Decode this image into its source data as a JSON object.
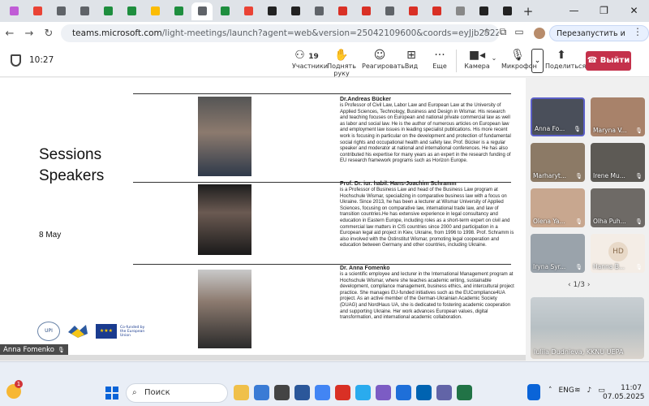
{
  "browser": {
    "tabs": [
      {
        "color": "#c05cd6"
      },
      {
        "color": "#ea4335"
      },
      {
        "color": "#5f6368"
      },
      {
        "color": "#5f6368"
      },
      {
        "color": "#1e8e3e"
      },
      {
        "color": "#1e8e3e"
      },
      {
        "color": "#fbbc04"
      },
      {
        "color": "#1e8e3e"
      },
      {
        "color": "#5f6368",
        "active": true
      },
      {
        "color": "#1e8e3e"
      },
      {
        "color": "#ea4335"
      },
      {
        "color": "#222222"
      },
      {
        "color": "#222222"
      },
      {
        "color": "#5f6368"
      },
      {
        "color": "#d93025"
      },
      {
        "color": "#d93025"
      },
      {
        "color": "#5f6368"
      },
      {
        "color": "#d93025"
      },
      {
        "color": "#d93025"
      },
      {
        "color": "#888888"
      },
      {
        "color": "#222222"
      },
      {
        "color": "#222222"
      }
    ],
    "new_tab": "+",
    "url_main": "teams.microsoft.com",
    "url_rest": "/light-meetings/launch?agent=web&version=25042109600&coords=eyJjb252ZXJzYXRpb25JZCI6Ij...",
    "relaunch_label": "Перезапустить и обновить"
  },
  "meeting": {
    "time": "10:27",
    "participants_count": "19",
    "participants_label": "Участники",
    "raise_hand_label": "Поднять руку",
    "react_label": "Реагировать",
    "view_label": "Вид",
    "more_label": "Еще",
    "camera_label": "Камера",
    "mic_label": "Микрофон",
    "share_label": "Поделиться",
    "leave_label": "Выйти"
  },
  "slide": {
    "title_line1": "Sessions",
    "title_line2": "Speakers",
    "date": "8 May",
    "speakers": [
      {
        "name": "Dr.Andreas Bücker",
        "bio": "is Professor of Civil Law, Labor Law and European Law at the University of Applied Sciences, Technology, Business and Design in Wismar. His research and teaching focuses on European and national private commercial law as well as labor and social law. He is the author of numerous articles on European law and employment law issues in leading specialist publications. His more recent work is focusing in particular on the development and protection of fundamental social rights and occupational health and safety law. Prof. Bücker is a regular speaker and moderator at national and international conferences. He has also contributed his expertise for many years as an expert in the research funding of EU research framework programs such as Horizon Europe."
      },
      {
        "name": "Prof. Dr. iur. habil. Hans-Joachim Schramm",
        "bio": "is a Professor of Business Law and head of the Business Law program at Hochschule Wismar, specializing in comparative business law with a focus on Ukraine. Since 2013, he has been a lecturer at Wismar University of Applied Sciences, focusing on comparative law, international trade law, and law of transition countries.He has extensive experience in legal consultancy and education in Eastern Europe, including roles as a short-term expert on civil and commercial law matters in CIS countries since 2000 and participation in a European legal aid project in Kiev, Ukraine, from 1996 to 1998. Prof. Schramm is also involved with the Ostinstitut Wismar, promoting legal cooperation and education between Germany and other countries, including Ukraine."
      },
      {
        "name": "Dr. Anna Fomenko",
        "bio": "is a scientific employee and lecturer in the International Management program at Hochschule Wismar, where she teaches academic writing, sustainable development, compliance management, business ethics, and intercultural project practice. She manages EU-funded initiatives such as the EUCompliance4UA project. As an active member of the German-Ukrainian Academic Society (DUAG) and NordHaus UA, she is dedicated to fostering academic cooperation and supporting Ukraine. Her work advances European values, digital transformation, and international academic collaboration."
      }
    ],
    "logo_upi": "UPI",
    "logo_eu": "★★★",
    "logo_eu_text": "Co-funded by the European Union",
    "presenter_caption": "Anna Fomenko"
  },
  "participants": [
    {
      "name": "Anna Fo...",
      "bg": "#4a4f5a",
      "selected": true
    },
    {
      "name": "Maryna V...",
      "bg": "#a8826a"
    },
    {
      "name": "Marharyt...",
      "bg": "#8c7a66"
    },
    {
      "name": "Irene Mu...",
      "bg": "#5d5a55"
    },
    {
      "name": "Olena Ya...",
      "bg": "#c8a78f"
    },
    {
      "name": "Olha Puh...",
      "bg": "#6e6a66"
    },
    {
      "name": "Iryna Syr...",
      "bg": "#9aa3ab"
    },
    {
      "name": "Hanna B...",
      "bg": "#f4ede6",
      "initials": "HD"
    }
  ],
  "pager": "1/3",
  "big_tile_name": "Iuliia Dudnieva, KKNU UEPA",
  "taskbar": {
    "weather_badge": "1",
    "search_placeholder": "Поиск",
    "lang": "ENG",
    "time": "11:07",
    "date": "07.05.2025",
    "app_colors": [
      "#f0c04a",
      "#3a7bd5",
      "#444444",
      "#2b579a",
      "#4285f4",
      "#d93025",
      "#2aabee",
      "#7c5cc4",
      "#1e6fd9",
      "#0063b1",
      "#6264a7",
      "#217346"
    ]
  }
}
